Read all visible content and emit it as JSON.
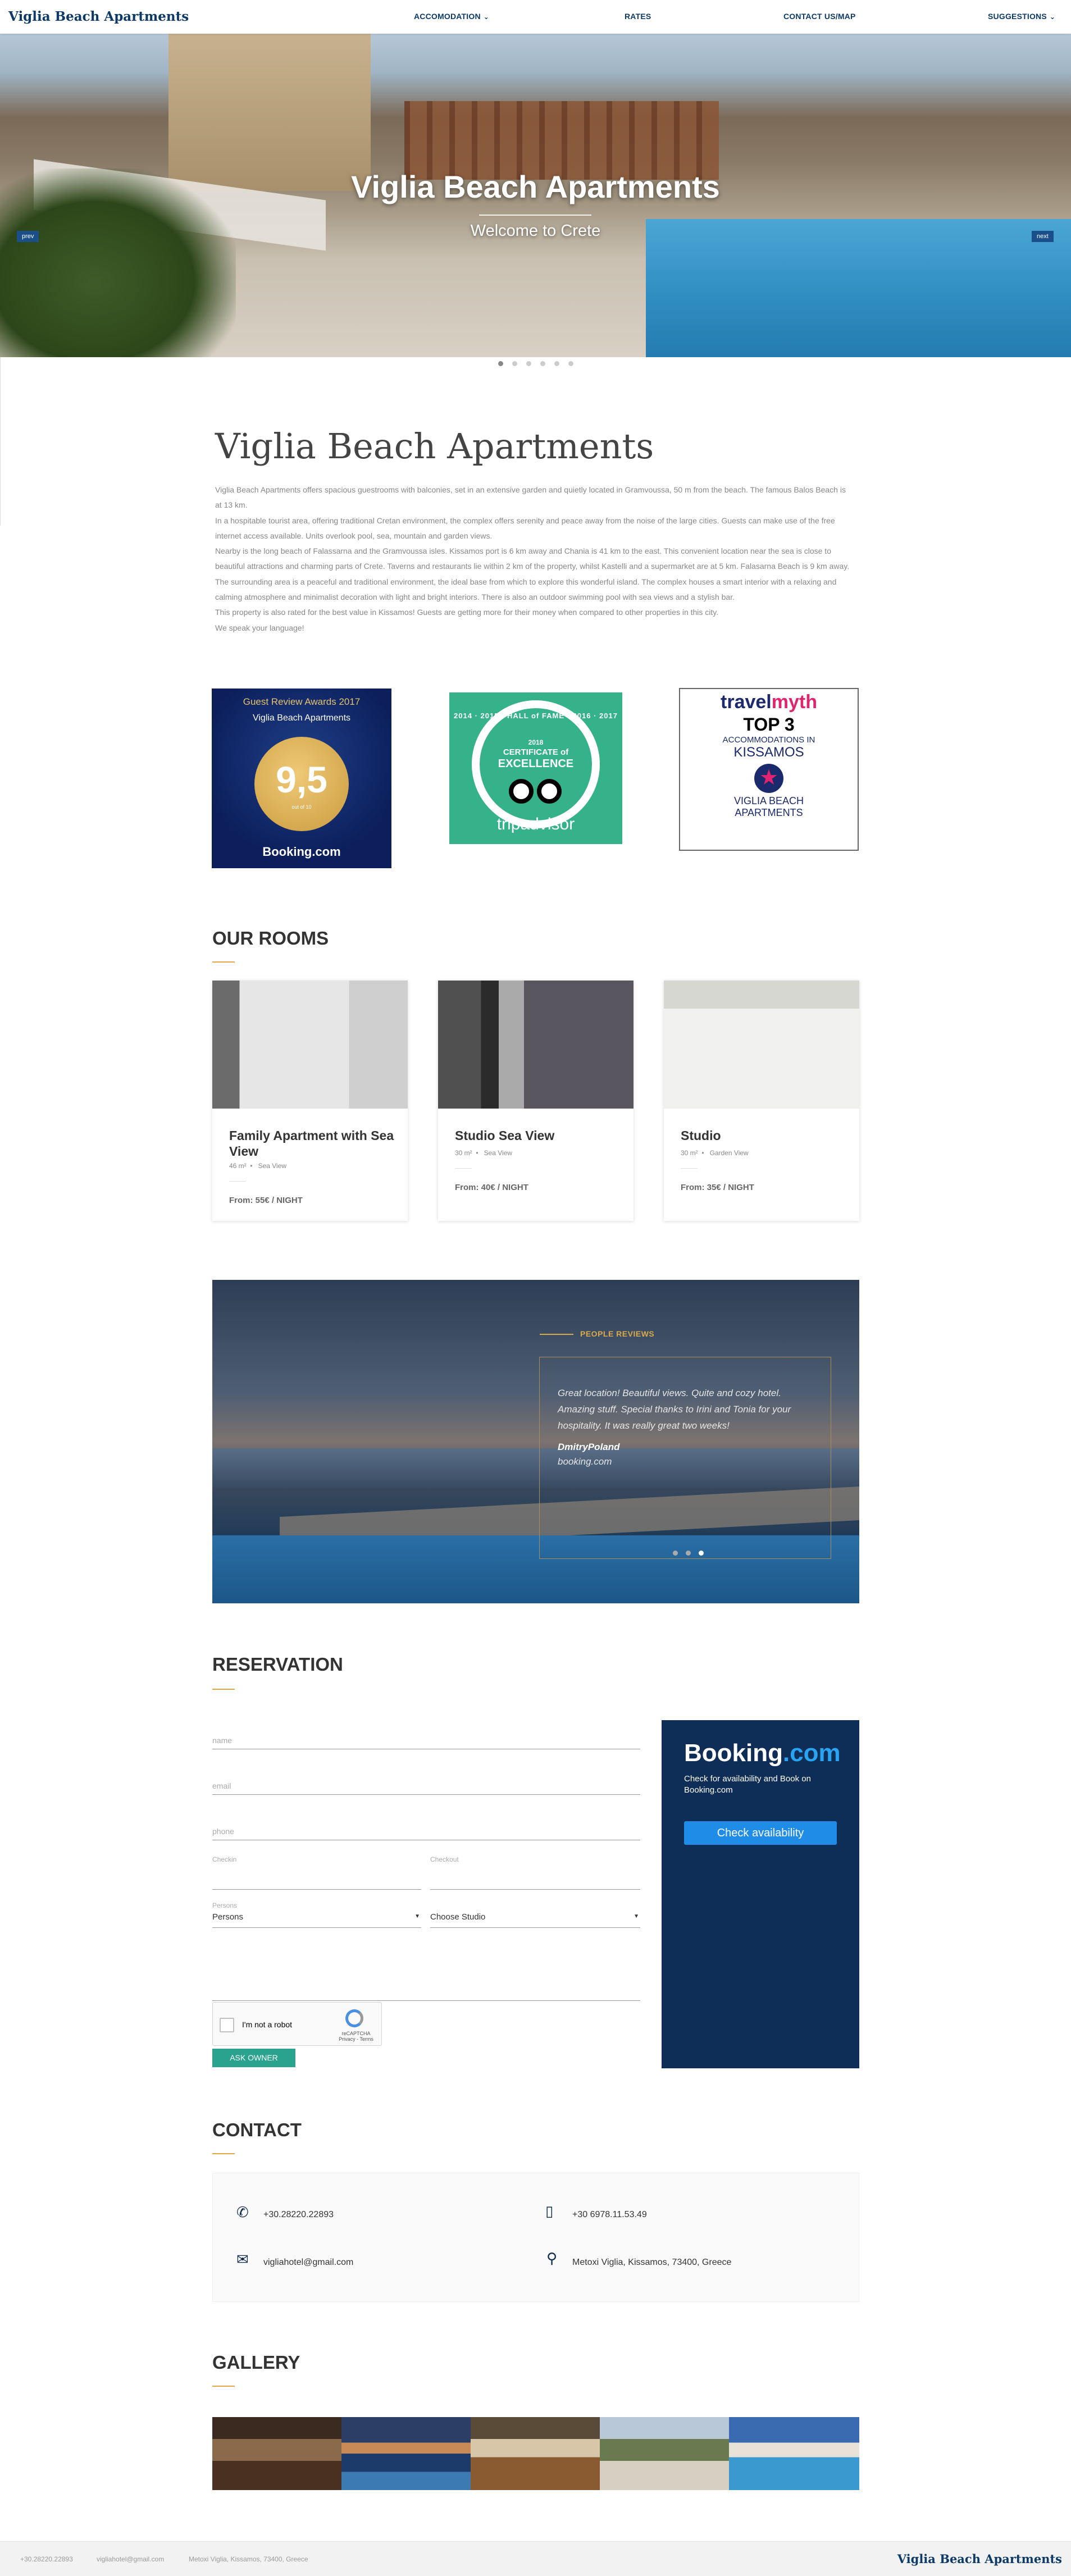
{
  "nav": {
    "brand": "Viglia Beach Apartments",
    "items": [
      {
        "label": "ACCOMODATION",
        "has_dropdown": true
      },
      {
        "label": "RATES",
        "has_dropdown": false
      },
      {
        "label": "CONTACT US/MAP",
        "has_dropdown": false
      },
      {
        "label": "SUGGESTIONS",
        "has_dropdown": true
      }
    ]
  },
  "hero": {
    "title": "Viglia Beach Apartments",
    "subtitle": "Welcome to Crete",
    "prev": "prev",
    "next": "next",
    "slide_count": 6,
    "active_slide": 1
  },
  "intro": {
    "title": "Viglia Beach Apartments",
    "paragraphs": [
      "Viglia Beach Apartments offers spacious guestrooms with balconies, set in an extensive garden and quietly located in Gramvoussa, 50 m from the beach. The famous Balos Beach is at 13 km.",
      "In a hospitable tourist area, offering traditional Cretan environment, the complex offers serenity and peace away from the noise of the large cities. Guests can make use of the free internet access available. Units overlook pool, sea, mountain and garden views.",
      "Nearby is the long beach of Falassarna and the Gramvoussa isles. Kissamos port is 6 km away and Chania is 41 km to the east. This convenient location near the sea is close to beautiful attractions and charming parts of Crete. Taverns and restaurants lie within 2 km of the property, whilst Kastelli and a supermarket are at 5 km. Falasarna Beach is 9 km away.",
      "The surrounding area is a peaceful and traditional environment, the ideal base from which to explore this wonderful island. The complex houses a smart interior with a relaxing and calming atmosphere and minimalist decoration with light and bright interiors. There is also an outdoor swimming pool with sea views and a stylish bar.",
      "This property is also rated for the best value in Kissamos! Guests are getting more for their money when compared to other properties in this city.",
      "We speak your language!"
    ]
  },
  "awards": {
    "booking": {
      "line1": "Guest Review Awards 2017",
      "line2": "Viglia Beach Apartments",
      "score": "9,5",
      "small": "out of 10",
      "brand": "Booking.com"
    },
    "tripadvisor": {
      "arc": "2014 · 2015 · HALL of FAME · 2016 · 2017",
      "year": "2018",
      "cert1": "CERTIFICATE of",
      "cert2": "EXCELLENCE",
      "brand": "tripadvisor"
    },
    "travelmyth": {
      "brand_a": "travel",
      "brand_b": "myth",
      "top": "TOP 3",
      "line1": "ACCOMMODATIONS IN",
      "line2": "KISSAMOS",
      "name1": "VIGLIA BEACH",
      "name2": "APARTMENTS"
    }
  },
  "rooms": {
    "title": "OUR ROOMS",
    "items": [
      {
        "name": "Family Apartment with Sea View",
        "area": "46 m²",
        "view": "Sea View",
        "price": "From: 55€ / NIGHT"
      },
      {
        "name": "Studio Sea View",
        "area": "30 m²",
        "view": "Sea View",
        "price": "From: 40€ / NIGHT"
      },
      {
        "name": "Studio",
        "area": "30 m²",
        "view": "Garden View",
        "price": "From: 35€ / NIGHT"
      }
    ]
  },
  "reviews": {
    "label": "PEOPLE REVIEWS",
    "text": "Great location! Beautiful views. Quite and cozy hotel. Amazing stuff. Special thanks to Irini and Tonia for your hospitality. It was really great two weeks!",
    "author": "DmitryPoland",
    "source": "booking.com",
    "dot_count": 3,
    "active_dot": 3
  },
  "reservation": {
    "title": "RESERVATION",
    "name_ph": "name",
    "email_ph": "email",
    "phone_ph": "phone",
    "checkin_label": "Checkin",
    "checkout_label": "Checkout",
    "persons_label": "Persons",
    "persons_value": "Persons",
    "studio_value": "Choose Studio",
    "captcha_label": "I'm not a robot",
    "captcha_brand": "reCAPTCHA",
    "captcha_terms": "Privacy - Terms",
    "submit": "ASK OWNER",
    "booking_logo_a": "Booking",
    "booking_logo_b": ".com",
    "booking_text": "Check for availability and Book on Booking.com",
    "booking_button": "Check availability"
  },
  "contact": {
    "title": "CONTACT",
    "phone": "+30.28220.22893",
    "mobile": "+30 6978.11.53.49",
    "email": "vigliahotel@gmail.com",
    "address": "Metoxi Viglia, Kissamos, 73400, Greece"
  },
  "gallery": {
    "title": "GALLERY"
  },
  "footer": {
    "phone": "+30.28220.22893",
    "email": "vigliahotel@gmail.com",
    "address": "Metoxi Viglia, Kissamos, 73400, Greece",
    "brand": "Viglia Beach Apartments"
  },
  "colors": {
    "brand": "#0d3a66",
    "accent": "#e0a84a",
    "button": "#2aa38e",
    "booking_bg": "#0e2d57"
  }
}
